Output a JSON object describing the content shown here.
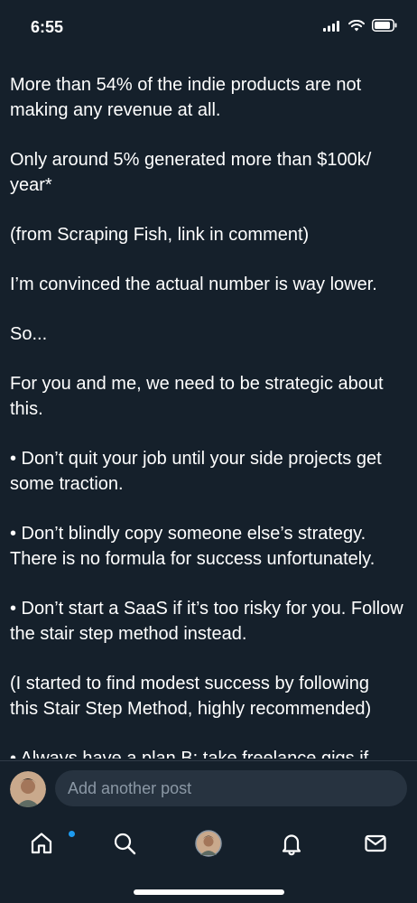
{
  "status_bar": {
    "time": "6:55"
  },
  "post": {
    "paragraphs": [
      "More than 54% of the indie products are not\nmaking any revenue at all.",
      "Only around 5% generated more than $100k/\nyear*",
      "(from Scraping Fish, link in comment)",
      "I’m convinced the actual number is way lower.",
      "So...",
      "For you and me, we need to be strategic about\nthis.",
      "• Don’t quit your job until your side projects get\nsome traction.",
      "• Don’t blindly copy someone else’s strategy.\nThere is no formula for success unfortunately.",
      "• Don’t start a SaaS if it’s too risky for you. Follow\nthe stair step method instead.",
      "(I started to find modest success by following\nthis Stair Step Method, highly recommended)",
      "• Always have a plan B: take freelance gigs if"
    ]
  },
  "compose": {
    "placeholder": "Add another post"
  },
  "tabbar": {
    "icons": [
      "home-icon",
      "search-icon",
      "profile-avatar",
      "bell-icon",
      "mail-icon"
    ],
    "notification_color": "#1d9bf0"
  },
  "colors": {
    "background": "#15202b",
    "text": "#ffffff",
    "muted": "#8b98a5",
    "input_bg": "#273340"
  }
}
